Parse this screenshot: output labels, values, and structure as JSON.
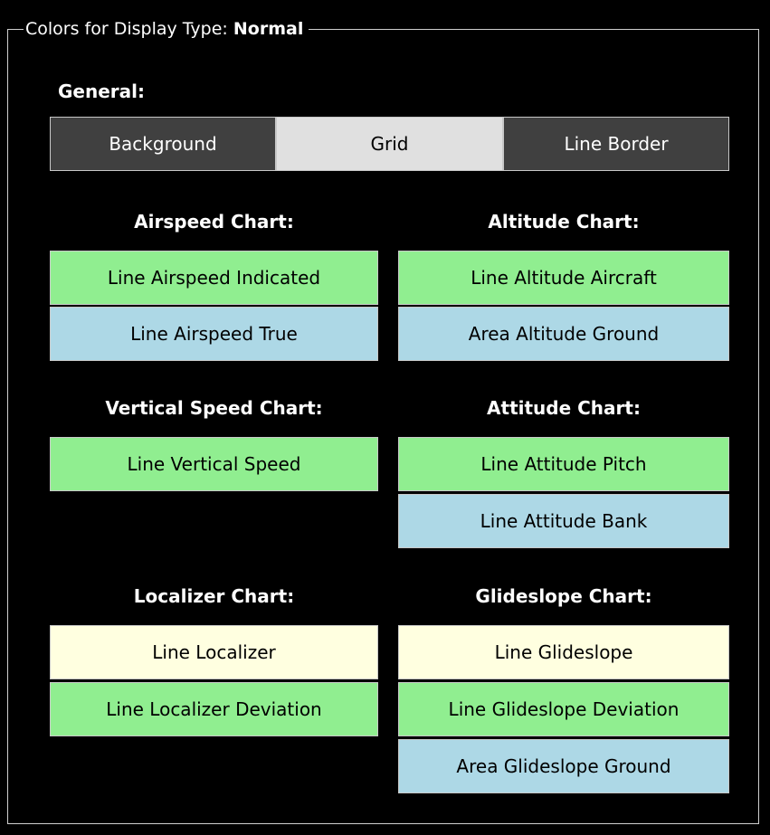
{
  "group": {
    "label": "Colors for Display Type:",
    "display_type": "Normal"
  },
  "general": {
    "title": "General:",
    "background_label": "Background",
    "grid_label": "Grid",
    "line_border_label": "Line Border"
  },
  "airspeed": {
    "title": "Airspeed Chart:",
    "indicated_label": "Line Airspeed Indicated",
    "true_label": "Line Airspeed True"
  },
  "altitude": {
    "title": "Altitude Chart:",
    "aircraft_label": "Line Altitude Aircraft",
    "ground_label": "Area Altitude Ground"
  },
  "vertical_speed": {
    "title": "Vertical Speed Chart:",
    "line_label": "Line Vertical Speed"
  },
  "attitude": {
    "title": "Attitude Chart:",
    "pitch_label": "Line Attitude Pitch",
    "bank_label": "Line Attitude Bank"
  },
  "localizer": {
    "title": "Localizer Chart:",
    "line_label": "Line Localizer",
    "deviation_label": "Line Localizer Deviation"
  },
  "glideslope": {
    "title": "Glideslope Chart:",
    "line_label": "Line Glideslope",
    "deviation_label": "Line Glideslope Deviation",
    "ground_label": "Area Glideslope Ground"
  },
  "colors": {
    "background_swatch": "#404040",
    "grid_swatch": "#e0e0e0",
    "line_border_swatch": "#404040",
    "green": "#90ee90",
    "blue": "#add8e6",
    "yellow": "#ffffe0"
  }
}
